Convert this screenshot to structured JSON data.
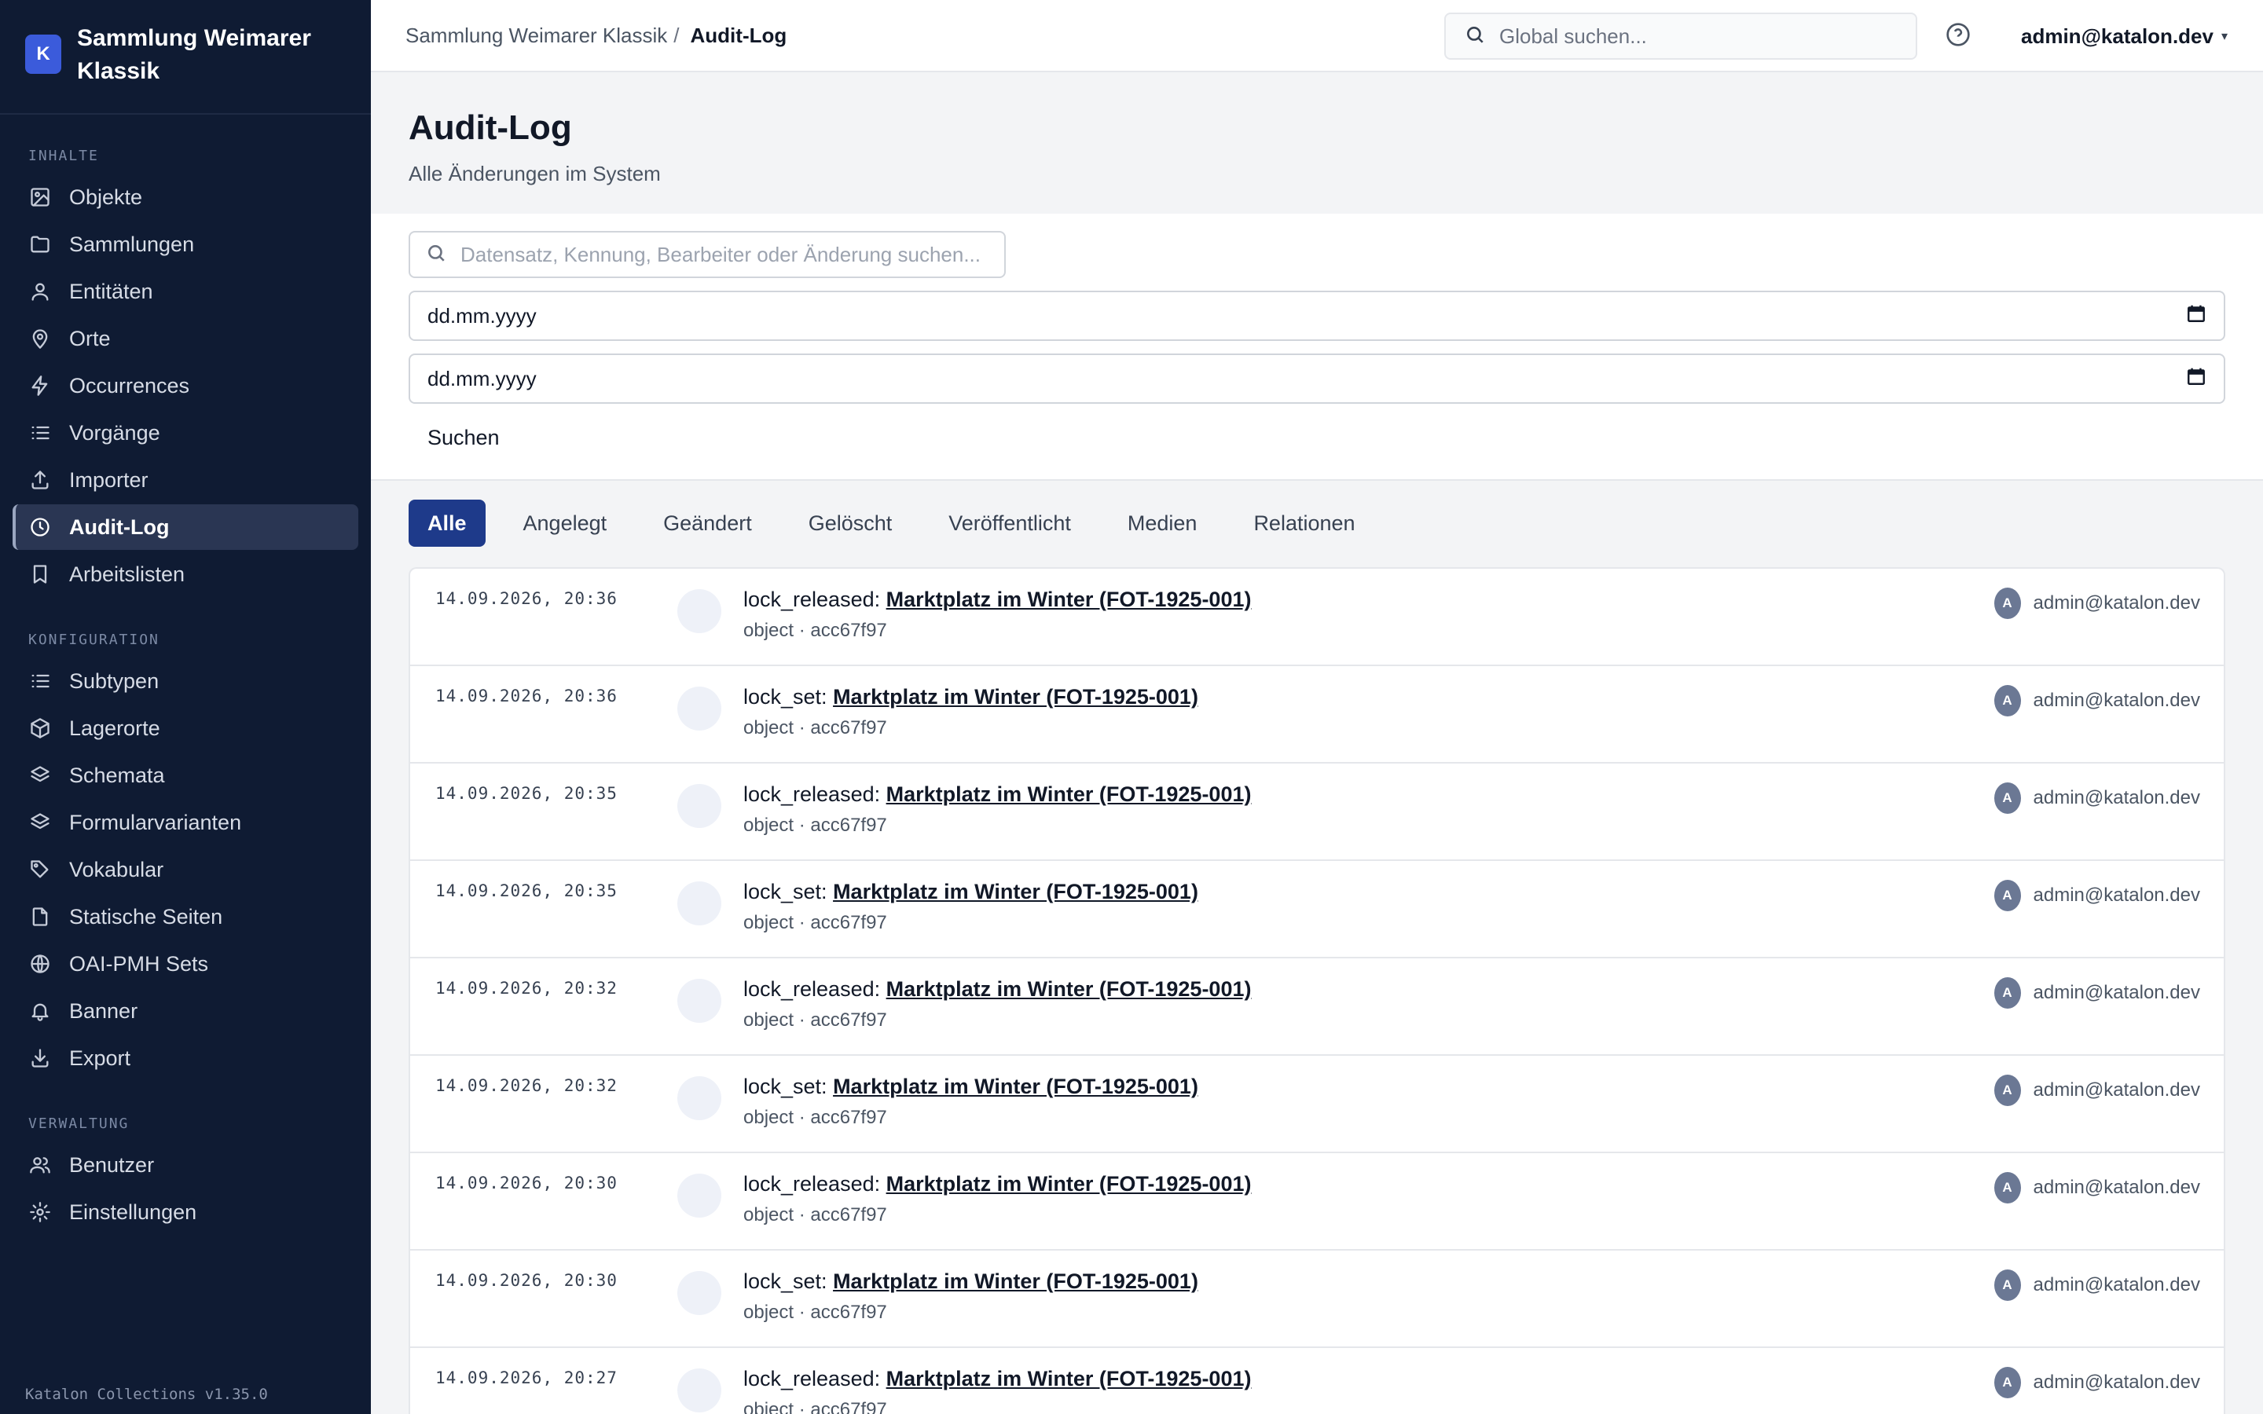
{
  "brand": {
    "logo_letter": "K",
    "name": "Sammlung Weimarer Klassik"
  },
  "sidebar": {
    "sections": [
      {
        "title": "INHALTE",
        "items": [
          {
            "label": "Objekte",
            "icon": "image-icon"
          },
          {
            "label": "Sammlungen",
            "icon": "folder-icon"
          },
          {
            "label": "Entitäten",
            "icon": "user-icon"
          },
          {
            "label": "Orte",
            "icon": "map-pin-icon"
          },
          {
            "label": "Occurrences",
            "icon": "bolt-icon"
          },
          {
            "label": "Vorgänge",
            "icon": "list-icon"
          },
          {
            "label": "Importer",
            "icon": "upload-icon"
          },
          {
            "label": "Audit-Log",
            "icon": "clock-icon",
            "active": true
          },
          {
            "label": "Arbeitslisten",
            "icon": "bookmark-icon"
          }
        ]
      },
      {
        "title": "KONFIGURATION",
        "items": [
          {
            "label": "Subtypen",
            "icon": "list-icon"
          },
          {
            "label": "Lagerorte",
            "icon": "box-icon"
          },
          {
            "label": "Schemata",
            "icon": "layers-icon"
          },
          {
            "label": "Formularvarianten",
            "icon": "layers-icon"
          },
          {
            "label": "Vokabular",
            "icon": "tag-icon"
          },
          {
            "label": "Statische Seiten",
            "icon": "file-icon"
          },
          {
            "label": "OAI-PMH Sets",
            "icon": "globe-icon"
          },
          {
            "label": "Banner",
            "icon": "bell-icon"
          },
          {
            "label": "Export",
            "icon": "download-icon"
          }
        ]
      },
      {
        "title": "VERWALTUNG",
        "items": [
          {
            "label": "Benutzer",
            "icon": "users-icon"
          },
          {
            "label": "Einstellungen",
            "icon": "gear-icon"
          }
        ]
      }
    ],
    "version": "Katalon Collections v1.35.0"
  },
  "topbar": {
    "breadcrumb_parent": "Sammlung Weimarer Klassik",
    "breadcrumb_sep": "/",
    "breadcrumb_current": "Audit-Log",
    "search_placeholder": "Global suchen...",
    "user": "admin@katalon.dev",
    "user_caret": "▾"
  },
  "page": {
    "title": "Audit-Log",
    "subtitle": "Alle Änderungen im System"
  },
  "filters": {
    "search_placeholder": "Datensatz, Kennung, Bearbeiter oder Änderung suchen...",
    "date_from": "dd.mm.yyyy",
    "date_to": "dd.mm.yyyy",
    "search_button": "Suchen"
  },
  "tabs": [
    {
      "label": "Alle",
      "active": true
    },
    {
      "label": "Angelegt"
    },
    {
      "label": "Geändert"
    },
    {
      "label": "Gelöscht"
    },
    {
      "label": "Veröffentlicht"
    },
    {
      "label": "Medien"
    },
    {
      "label": "Relationen"
    }
  ],
  "log_entries": [
    {
      "timestamp": "14.09.2026, 20:36",
      "action": "lock_released:",
      "target": "Marktplatz im Winter (FOT-1925-001)",
      "meta": "object · acc67f97",
      "avatar": "A",
      "actor": "admin@katalon.dev"
    },
    {
      "timestamp": "14.09.2026, 20:36",
      "action": "lock_set:",
      "target": "Marktplatz im Winter (FOT-1925-001)",
      "meta": "object · acc67f97",
      "avatar": "A",
      "actor": "admin@katalon.dev"
    },
    {
      "timestamp": "14.09.2026, 20:35",
      "action": "lock_released:",
      "target": "Marktplatz im Winter (FOT-1925-001)",
      "meta": "object · acc67f97",
      "avatar": "A",
      "actor": "admin@katalon.dev"
    },
    {
      "timestamp": "14.09.2026, 20:35",
      "action": "lock_set:",
      "target": "Marktplatz im Winter (FOT-1925-001)",
      "meta": "object · acc67f97",
      "avatar": "A",
      "actor": "admin@katalon.dev"
    },
    {
      "timestamp": "14.09.2026, 20:32",
      "action": "lock_released:",
      "target": "Marktplatz im Winter (FOT-1925-001)",
      "meta": "object · acc67f97",
      "avatar": "A",
      "actor": "admin@katalon.dev"
    },
    {
      "timestamp": "14.09.2026, 20:32",
      "action": "lock_set:",
      "target": "Marktplatz im Winter (FOT-1925-001)",
      "meta": "object · acc67f97",
      "avatar": "A",
      "actor": "admin@katalon.dev"
    },
    {
      "timestamp": "14.09.2026, 20:30",
      "action": "lock_released:",
      "target": "Marktplatz im Winter (FOT-1925-001)",
      "meta": "object · acc67f97",
      "avatar": "A",
      "actor": "admin@katalon.dev"
    },
    {
      "timestamp": "14.09.2026, 20:30",
      "action": "lock_set:",
      "target": "Marktplatz im Winter (FOT-1925-001)",
      "meta": "object · acc67f97",
      "avatar": "A",
      "actor": "admin@katalon.dev"
    },
    {
      "timestamp": "14.09.2026, 20:27",
      "action": "lock_released:",
      "target": "Marktplatz im Winter (FOT-1925-001)",
      "meta": "object · acc67f97",
      "avatar": "A",
      "actor": "admin@katalon.dev"
    }
  ],
  "colors": {
    "sidebar_bg": "#0f1b33",
    "accent": "#1e3a8a",
    "brand_logo": "#3b5bdb"
  }
}
